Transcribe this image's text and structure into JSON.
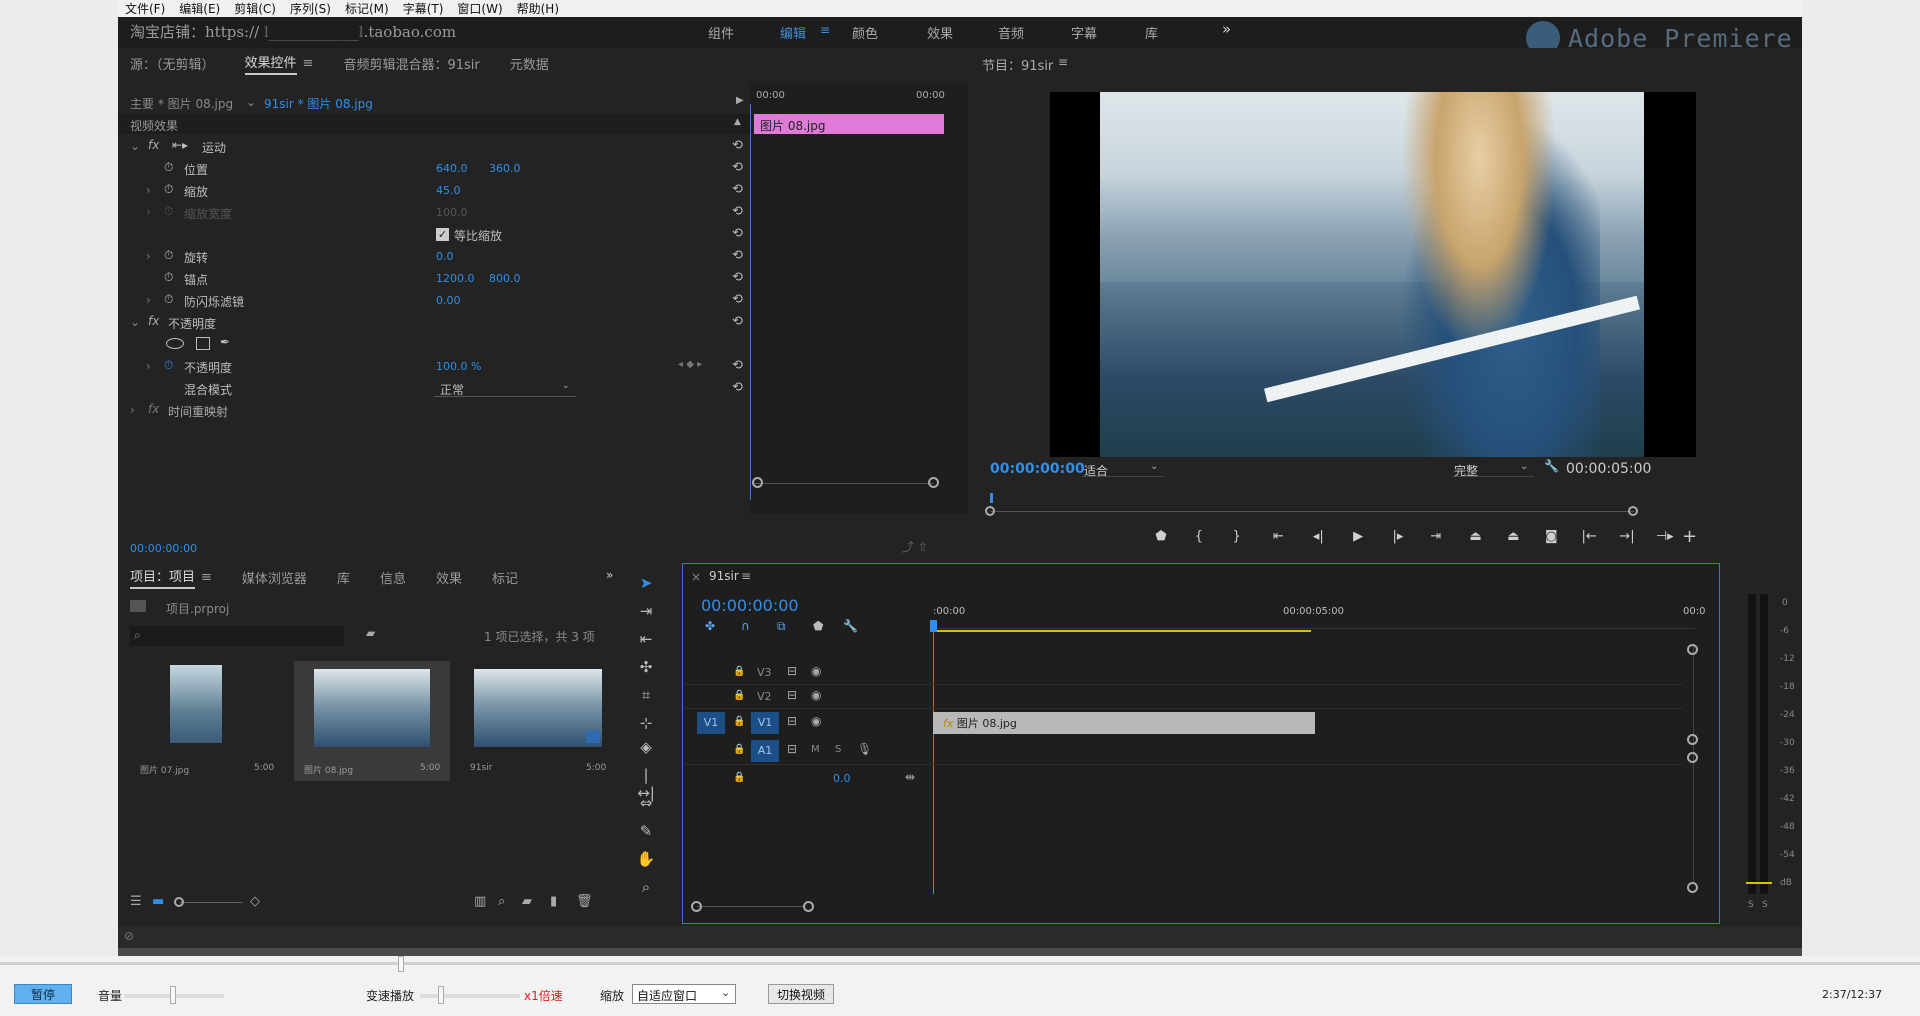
{
  "menu": [
    "文件(F)",
    "编辑(E)",
    "剪辑(C)",
    "序列(S)",
    "标记(M)",
    "字幕(T)",
    "窗口(W)",
    "帮助(H)"
  ],
  "watermark_shop": "淘宝店铺：https://",
  "watermark_url": ".taobao.com",
  "brand": "Adobe Premiere",
  "workspaces": [
    "组件",
    "编辑",
    "颜色",
    "效果",
    "音频",
    "字幕",
    "库"
  ],
  "workspace_more": "»",
  "source_panel": {
    "tabs": [
      "源：（无剪辑）",
      "效果控件",
      "音频剪辑混合器：91sir",
      "元数据"
    ],
    "clip_master": "主要 * 图片 08.jpg",
    "clip_seq": "91sir * 图片 08.jpg",
    "time_start": "00:00",
    "time_end": "00:00",
    "video_effects": "视频效果",
    "motion": "运动",
    "position": "位置",
    "position_x": "640.0",
    "position_y": "360.0",
    "scale": "缩放",
    "scale_val": "45.0",
    "scale_width": "缩放宽度",
    "scale_width_val": "100.0",
    "uniform_scale": "等比缩放",
    "rotation": "旋转",
    "rotation_val": "0.0",
    "anchor": "锚点",
    "anchor_x": "1200.0",
    "anchor_y": "800.0",
    "antiflicker": "防闪烁滤镜",
    "antiflicker_val": "0.00",
    "opacity_group": "不透明度",
    "opacity": "不透明度",
    "opacity_val": "100.0 %",
    "blend_mode": "混合模式",
    "blend_val": "正常",
    "time_remap": "时间重映射",
    "clip_bar": "图片 08.jpg",
    "timecode": "00:00:00:00"
  },
  "program": {
    "title": "节目：91sir",
    "timecode": "00:00:00:00",
    "fit": "适合",
    "quality": "完整",
    "duration": "00:00:05:00"
  },
  "project": {
    "tabs": [
      "项目：项目",
      "媒体浏览器",
      "库",
      "信息",
      "效果",
      "标记"
    ],
    "file": "项目.prproj",
    "selection": "1 项已选择，共 3 项",
    "items": [
      {
        "name": "图片 07.jpg",
        "dur": "5:00"
      },
      {
        "name": "图片 08.jpg",
        "dur": "5:00"
      },
      {
        "name": "91sir",
        "dur": "5:00"
      }
    ]
  },
  "timeline": {
    "title": "91sir",
    "timecode": "00:00:00:00",
    "ruler": [
      ":00:00",
      "00:00:05:00",
      "00:0"
    ],
    "tracks": [
      "V3",
      "V2",
      "V1",
      "A1"
    ],
    "src_v": "V1",
    "src_a": "A1",
    "audio_m": "M",
    "audio_s": "S",
    "clip": "图片 08.jpg",
    "vol": "0.0"
  },
  "meter": {
    "ticks": [
      "0",
      "-6",
      "-12",
      "-18",
      "-24",
      "-30",
      "-36",
      "-42",
      "-48",
      "-54",
      "dB"
    ],
    "s_left": "S",
    "s_right": "S"
  },
  "player": {
    "pause": "暂停",
    "volume": "音量",
    "speed": "变速播放",
    "speed_val": "x1倍速",
    "zoom": "缩放",
    "zoom_val": "自适应窗口",
    "switch": "切换视频",
    "time": "2:37/12:37"
  },
  "colors": {
    "accent": "#2f8fea",
    "clip_pink": "#e07ad8",
    "clip_gray": "#b8b8b8",
    "sel_border": "#3d76c2",
    "yellow": "#d4c400"
  }
}
